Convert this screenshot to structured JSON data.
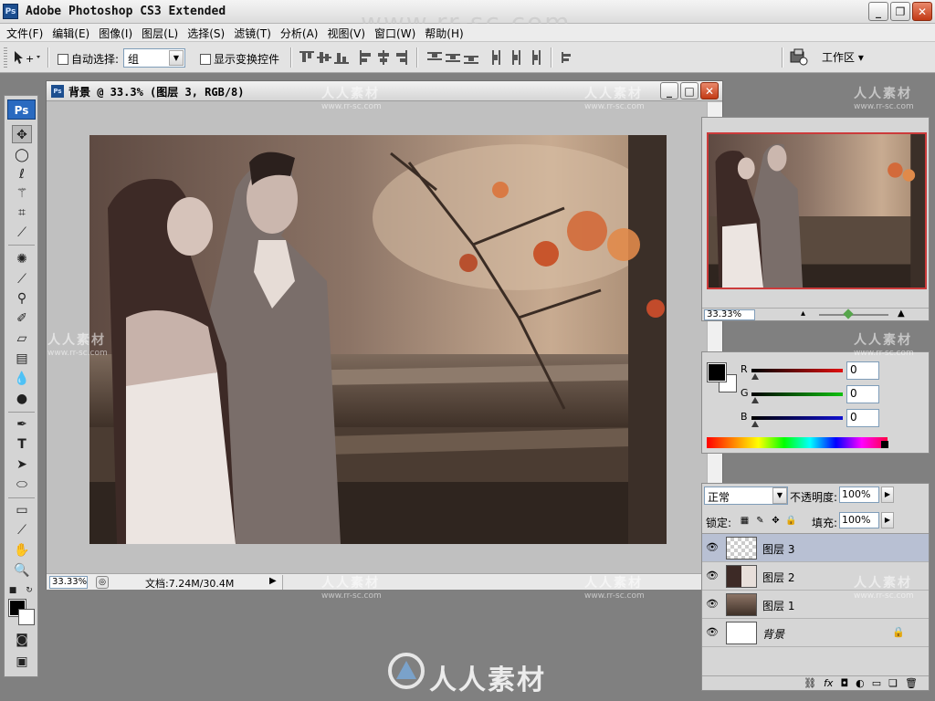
{
  "app": {
    "title": "Adobe Photoshop CS3 Extended",
    "ps_logo": "Ps",
    "watermark_url": "www.rr-sc.com"
  },
  "menu": {
    "items": [
      "文件(F)",
      "编辑(E)",
      "图像(I)",
      "图层(L)",
      "选择(S)",
      "滤镜(T)",
      "分析(A)",
      "视图(V)",
      "窗口(W)",
      "帮助(H)"
    ]
  },
  "options": {
    "auto_select_label": "自动选择:",
    "auto_select_value": "组",
    "show_transform_label": "显示变换控件",
    "workspace_label": "工作区 ▾"
  },
  "toolbox": {
    "badge": "Ps"
  },
  "document": {
    "title": "背景 @ 33.3% (图层 3, RGB/8)",
    "zoom": "33.33%",
    "docinfo": "文档:7.24M/30.4M"
  },
  "navigator": {
    "zoom": "33.33%"
  },
  "color": {
    "channels": [
      {
        "label": "R",
        "value": "0",
        "color": "#e01010"
      },
      {
        "label": "G",
        "value": "0",
        "color": "#10c010"
      },
      {
        "label": "B",
        "value": "0",
        "color": "#1010d0"
      }
    ]
  },
  "layers": {
    "blend_mode": "正常",
    "opacity_label": "不透明度:",
    "opacity_value": "100%",
    "lock_label": "锁定:",
    "fill_label": "填充:",
    "fill_value": "100%",
    "items": [
      {
        "name": "图层 3",
        "selected": true
      },
      {
        "name": "图层 2",
        "selected": false
      },
      {
        "name": "图层 1",
        "selected": false
      },
      {
        "name": "背景",
        "selected": false,
        "locked": true
      }
    ]
  },
  "watermarks": {
    "cn": "人人素材",
    "url": "www.rr-sc.com",
    "footer": "人人素材"
  }
}
